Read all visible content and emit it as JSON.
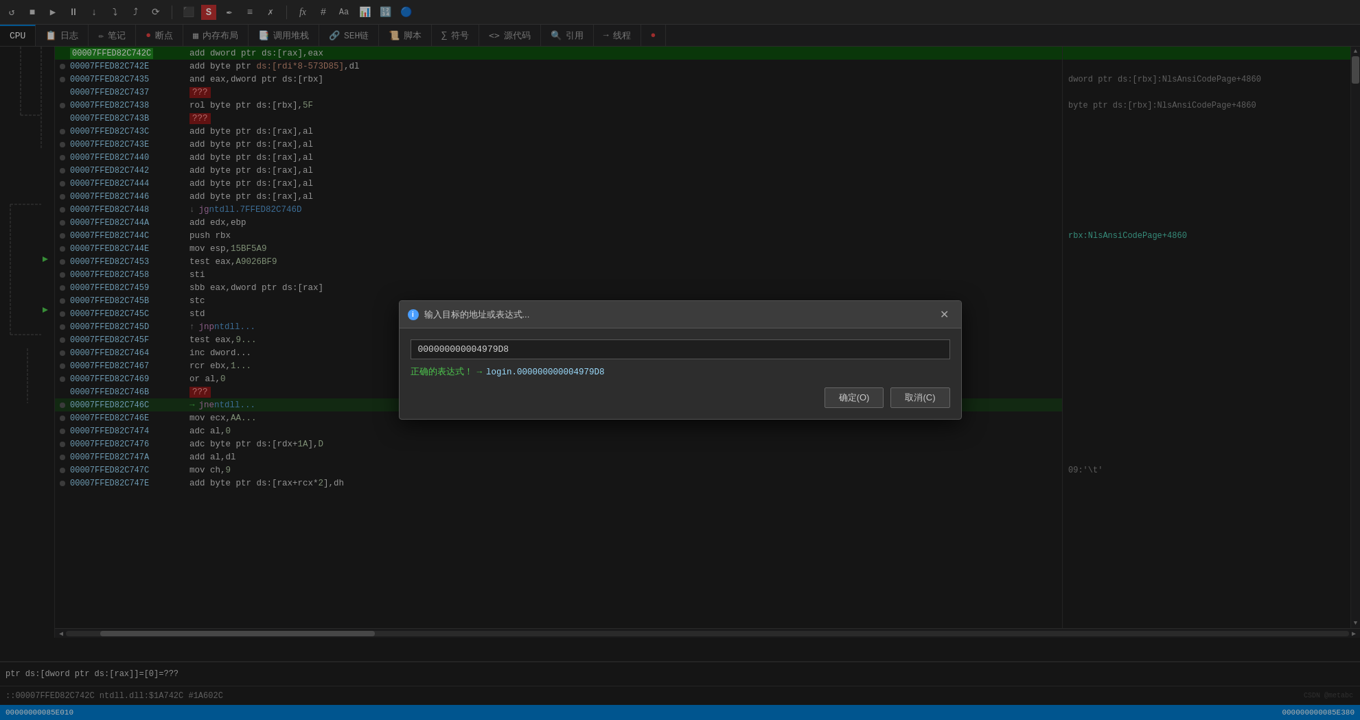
{
  "toolbar": {
    "buttons": [
      "↺",
      "■",
      "▶",
      "⏸",
      "⟳",
      "↻",
      "↓",
      "⤵",
      "⤴",
      "⬛",
      "S",
      "✒",
      "≡",
      "✗",
      "fx",
      "#",
      "Aa",
      "📊",
      "🔢",
      "🔵"
    ]
  },
  "tabs": [
    {
      "label": "CPU",
      "active": true,
      "icon": ""
    },
    {
      "label": "日志",
      "active": false,
      "icon": "📋"
    },
    {
      "label": "笔记",
      "active": false,
      "icon": "✏️"
    },
    {
      "label": "断点",
      "active": false,
      "icon": "🔴"
    },
    {
      "label": "内存布局",
      "active": false,
      "icon": "▦"
    },
    {
      "label": "调用堆栈",
      "active": false,
      "icon": "📑"
    },
    {
      "label": "SEH链",
      "active": false,
      "icon": "🔗"
    },
    {
      "label": "脚本",
      "active": false,
      "icon": "📜"
    },
    {
      "label": "符号",
      "active": false,
      "icon": "∑"
    },
    {
      "label": "源代码",
      "active": false,
      "icon": "<>"
    },
    {
      "label": "引用",
      "active": false,
      "icon": "🔍"
    },
    {
      "label": "线程",
      "active": false,
      "icon": "→"
    },
    {
      "label": "...",
      "active": false,
      "icon": ""
    }
  ],
  "code_lines": [
    {
      "addr": "00007FFED82C742C",
      "current": true,
      "has_bp": false,
      "asm": "add dword ptr ds:[rax],eax",
      "comment": ""
    },
    {
      "addr": "00007FFED82C742E",
      "current": false,
      "has_bp": false,
      "asm": "add byte ptr ds:[rdi*8-573D85],dl",
      "comment": ""
    },
    {
      "addr": "00007FFED82C7435",
      "current": false,
      "has_bp": false,
      "asm": "and eax,dword ptr ds:[rbx]",
      "comment": "dword ptr ds:[rbx]:NlsAnsiCodePage+4860"
    },
    {
      "addr": "00007FFED82C7437",
      "current": false,
      "has_bp": false,
      "asm": "???",
      "is_bad": true,
      "comment": ""
    },
    {
      "addr": "00007FFED82C7438",
      "current": false,
      "has_bp": false,
      "asm": "rol byte ptr ds:[rbx],5F",
      "comment": "byte ptr ds:[rbx]:NlsAnsiCodePage+4860"
    },
    {
      "addr": "00007FFED82C743B",
      "current": false,
      "has_bp": false,
      "asm": "???",
      "is_bad": true,
      "comment": ""
    },
    {
      "addr": "00007FFED82C743C",
      "current": false,
      "has_bp": false,
      "asm": "add byte ptr ds:[rax],al",
      "comment": ""
    },
    {
      "addr": "00007FFED82C743E",
      "current": false,
      "has_bp": false,
      "asm": "add byte ptr ds:[rax],al",
      "comment": ""
    },
    {
      "addr": "00007FFED82C7440",
      "current": false,
      "has_bp": false,
      "asm": "add byte ptr ds:[rax],al",
      "comment": ""
    },
    {
      "addr": "00007FFED82C7442",
      "current": false,
      "has_bp": false,
      "asm": "add byte ptr ds:[rax],al",
      "comment": ""
    },
    {
      "addr": "00007FFED82C7444",
      "current": false,
      "has_bp": false,
      "asm": "add byte ptr ds:[rax],al",
      "comment": ""
    },
    {
      "addr": "00007FFED82C7446",
      "current": false,
      "has_bp": false,
      "asm": "add byte ptr ds:[rax],al",
      "comment": ""
    },
    {
      "addr": "00007FFED82C7448",
      "current": false,
      "has_bp": false,
      "asm": "jg ntdll.7FFED82C746D",
      "is_jmp": true,
      "comment": ""
    },
    {
      "addr": "00007FFED82C744A",
      "current": false,
      "has_bp": false,
      "asm": "add edx,ebp",
      "comment": ""
    },
    {
      "addr": "00007FFED82C744C",
      "current": false,
      "has_bp": false,
      "asm": "push rbx",
      "comment": "rbx:NlsAnsiCodePage+4860"
    },
    {
      "addr": "00007FFED82C744E",
      "current": false,
      "has_bp": false,
      "asm": "mov esp,15BF5A9",
      "comment": ""
    },
    {
      "addr": "00007FFED82C7453",
      "current": false,
      "has_bp": false,
      "asm": "test eax,A9026BF9",
      "comment": ""
    },
    {
      "addr": "00007FFED82C7458",
      "current": false,
      "has_bp": false,
      "asm": "sti",
      "comment": ""
    },
    {
      "addr": "00007FFED82C7459",
      "current": false,
      "has_bp": false,
      "asm": "sbb eax,dword ptr ds:[rax]",
      "comment": ""
    },
    {
      "addr": "00007FFED82C745B",
      "current": false,
      "has_bp": false,
      "asm": "stc",
      "comment": ""
    },
    {
      "addr": "00007FFED82C745C",
      "current": false,
      "has_bp": false,
      "asm": "std",
      "comment": ""
    },
    {
      "addr": "00007FFED82C745D",
      "current": false,
      "has_bp": false,
      "asm": "jnp ntdll...",
      "is_jmp": true,
      "comment": ""
    },
    {
      "addr": "00007FFED82C745F",
      "current": false,
      "has_bp": false,
      "asm": "test eax,9...",
      "comment": ""
    },
    {
      "addr": "00007FFED82C7464",
      "current": false,
      "has_bp": false,
      "asm": "inc dword...",
      "comment": ""
    },
    {
      "addr": "00007FFED82C7467",
      "current": false,
      "has_bp": false,
      "asm": "rcr ebx,1...",
      "comment": ""
    },
    {
      "addr": "00007FFED82C7469",
      "current": false,
      "has_bp": false,
      "asm": "or al,0",
      "comment": ""
    },
    {
      "addr": "00007FFED82C746B",
      "current": false,
      "has_bp": false,
      "asm": "???",
      "is_bad": true,
      "comment": ""
    },
    {
      "addr": "00007FFED82C746C",
      "current": false,
      "has_bp": false,
      "asm": "jne ntdll...",
      "is_jmp": true,
      "comment": ""
    },
    {
      "addr": "00007FFED82C746E",
      "current": false,
      "has_bp": false,
      "asm": "mov ecx,AA...",
      "comment": ""
    },
    {
      "addr": "00007FFED82C7474",
      "current": false,
      "has_bp": false,
      "asm": "adc al,0",
      "comment": ""
    },
    {
      "addr": "00007FFED82C7476",
      "current": false,
      "has_bp": false,
      "asm": "adc byte ptr ds:[rdx+1A],D",
      "comment": ""
    },
    {
      "addr": "00007FFED82C747A",
      "current": false,
      "has_bp": false,
      "asm": "add al,dl",
      "comment": ""
    },
    {
      "addr": "00007FFED82C747C",
      "current": false,
      "has_bp": false,
      "asm": "mov ch,9",
      "comment": "09:'\\t'"
    },
    {
      "addr": "00007FFED82C747E",
      "current": false,
      "has_bp": false,
      "asm": "add byte ptr ds:[rax+rcx*2],dh",
      "comment": ""
    }
  ],
  "bottom_info": "ptr ds:[dword ptr ds:[rax]]=[0]=???",
  "bottom_addr": "::00007FFED82C742C ntdll.dll:$1A742C #1A602C",
  "dialog": {
    "title": "输入目标的地址或表达式...",
    "input_value": "000000000004979D8",
    "validation_text": "正确的表达式！",
    "validation_arrow": "→",
    "validation_result": "login.000000000004979D8",
    "btn_confirm": "确定(O)",
    "btn_cancel": "取消(C)"
  },
  "statusbar": {
    "left": "00000000085E010",
    "right": "000000000085E380"
  },
  "register_comment": "09:'\\t'"
}
